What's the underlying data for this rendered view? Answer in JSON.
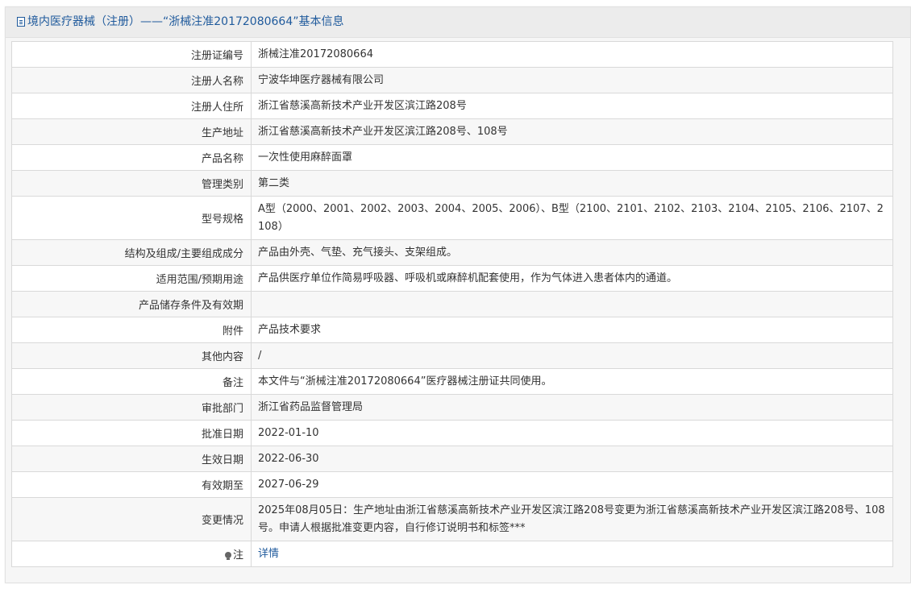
{
  "header": {
    "title": "境内医疗器械（注册）——“浙械注准20172080664”基本信息"
  },
  "rows": [
    {
      "label": "注册证编号",
      "value": "浙械注准20172080664"
    },
    {
      "label": "注册人名称",
      "value": "宁波华坤医疗器械有限公司"
    },
    {
      "label": "注册人住所",
      "value": "浙江省慈溪高新技术产业开发区滨江路208号"
    },
    {
      "label": "生产地址",
      "value": "浙江省慈溪高新技术产业开发区滨江路208号、108号"
    },
    {
      "label": "产品名称",
      "value": "一次性使用麻醉面罩"
    },
    {
      "label": "管理类别",
      "value": "第二类"
    },
    {
      "label": "型号规格",
      "value": "A型（2000、2001、2002、2003、2004、2005、2006）、B型（2100、2101、2102、2103、2104、2105、2106、2107、2108）"
    },
    {
      "label": "结构及组成/主要组成成分",
      "value": "产品由外壳、气垫、充气接头、支架组成。"
    },
    {
      "label": "适用范围/预期用途",
      "value": "产品供医疗单位作简易呼吸器、呼吸机或麻醉机配套使用，作为气体进入患者体内的通道。"
    },
    {
      "label": "产品储存条件及有效期",
      "value": ""
    },
    {
      "label": "附件",
      "value": "产品技术要求"
    },
    {
      "label": "其他内容",
      "value": "/"
    },
    {
      "label": "备注",
      "value": "本文件与“浙械注准20172080664”医疗器械注册证共同使用。"
    },
    {
      "label": "审批部门",
      "value": "浙江省药品监督管理局"
    },
    {
      "label": "批准日期",
      "value": "2022-01-10"
    },
    {
      "label": "生效日期",
      "value": "2022-06-30"
    },
    {
      "label": "有效期至",
      "value": "2027-06-29"
    },
    {
      "label": "变更情况",
      "value": "2025年08月05日：生产地址由浙江省慈溪高新技术产业开发区滨江路208号变更为浙江省慈溪高新技术产业开发区滨江路208号、108号。申请人根据批准变更内容，自行修订说明书和标签***"
    }
  ],
  "note": {
    "icon": "lightbulb-icon",
    "label": "注",
    "link_text": "详情"
  },
  "colors": {
    "link": "#1f5a9c",
    "header_bg": "#ececec",
    "border": "#d9d9d9",
    "stripe": "#f7f7f7"
  }
}
